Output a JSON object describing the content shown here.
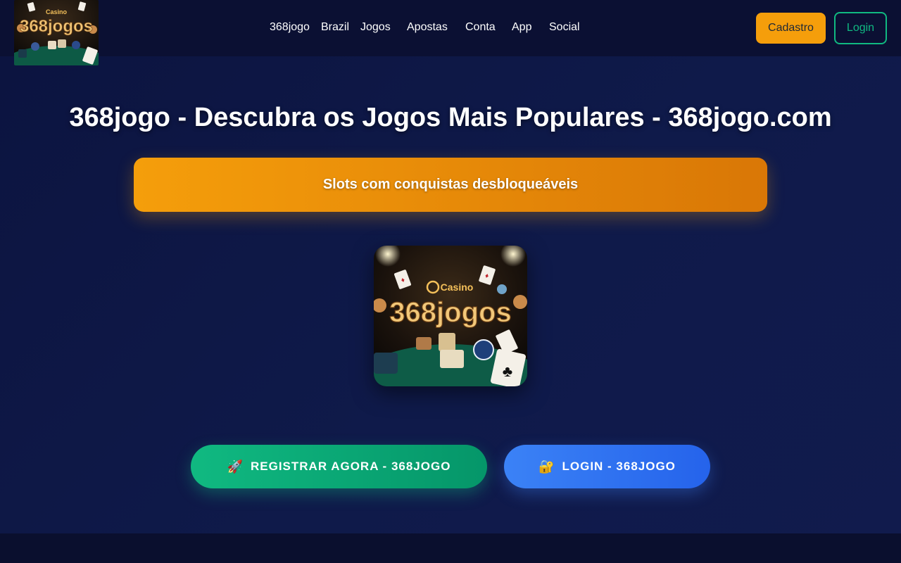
{
  "header": {
    "logo": {
      "brand_small": "Casino",
      "brand_main": "368jogos"
    },
    "nav": [
      {
        "label": "368jogo"
      },
      {
        "label": "Brazil"
      },
      {
        "label": "Jogos"
      },
      {
        "label": "Apostas"
      },
      {
        "label": "Conta"
      },
      {
        "label": "App"
      },
      {
        "label": "Social"
      }
    ],
    "cadastro_label": "Cadastro",
    "login_label": "Login"
  },
  "main": {
    "title": "368jogo - Descubra os Jogos Mais Populares - 368jogo.com",
    "banner_text": "Slots com conquistas desbloqueáveis",
    "hero_image": {
      "brand_small": "Casino",
      "brand_main": "368jogos"
    },
    "cta_register": {
      "icon": "rocket-icon",
      "label": "REGISTRAR AGORA - 368JOGO"
    },
    "cta_login": {
      "icon": "lock-icon",
      "label": "LOGIN - 368JOGO"
    }
  },
  "colors": {
    "accent_orange": "#f59e0b",
    "accent_green": "#10b981",
    "accent_blue": "#3b82f6",
    "background": "#0b1030"
  }
}
